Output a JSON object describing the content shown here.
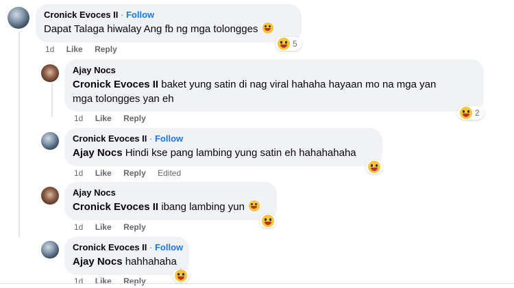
{
  "comments": [
    {
      "author": "Cronick Evoces II",
      "follow": "Follow",
      "mention": "",
      "text": "Dapat Talaga hiwalay Ang fb ng mga tolongges",
      "time": "1d",
      "like": "Like",
      "reply": "Reply",
      "edited": "",
      "reaction_count": "5"
    },
    {
      "author": "Ajay Nocs",
      "follow": "",
      "mention": "Cronick Evoces II",
      "text": "baket yung satin di nag viral hahaha hayaan mo na mga yan",
      "text2": "mga tolongges yan eh",
      "time": "1d",
      "like": "Like",
      "reply": "Reply",
      "edited": "",
      "reaction_count": "2"
    },
    {
      "author": "Cronick Evoces II",
      "follow": "Follow",
      "mention": "Ajay Nocs",
      "text": "Hindi kse pang lambing yung satin eh hahahahaha",
      "time": "1d",
      "like": "Like",
      "reply": "Reply",
      "edited": "Edited",
      "reaction_count": ""
    },
    {
      "author": "Ajay Nocs",
      "follow": "",
      "mention": "Cronick Evoces II",
      "text": "ibang lambing yun",
      "time": "1d",
      "like": "Like",
      "reply": "Reply",
      "edited": "",
      "reaction_count": ""
    },
    {
      "author": "Cronick Evoces II",
      "follow": "Follow",
      "mention": "Ajay Nocs",
      "text": "hahhahaha",
      "time": "1d",
      "like": "Like",
      "reply": "Reply",
      "edited": "",
      "reaction_count": ""
    }
  ],
  "separator": "·",
  "icons": {
    "reaction": "laughing-emoji-icon"
  }
}
